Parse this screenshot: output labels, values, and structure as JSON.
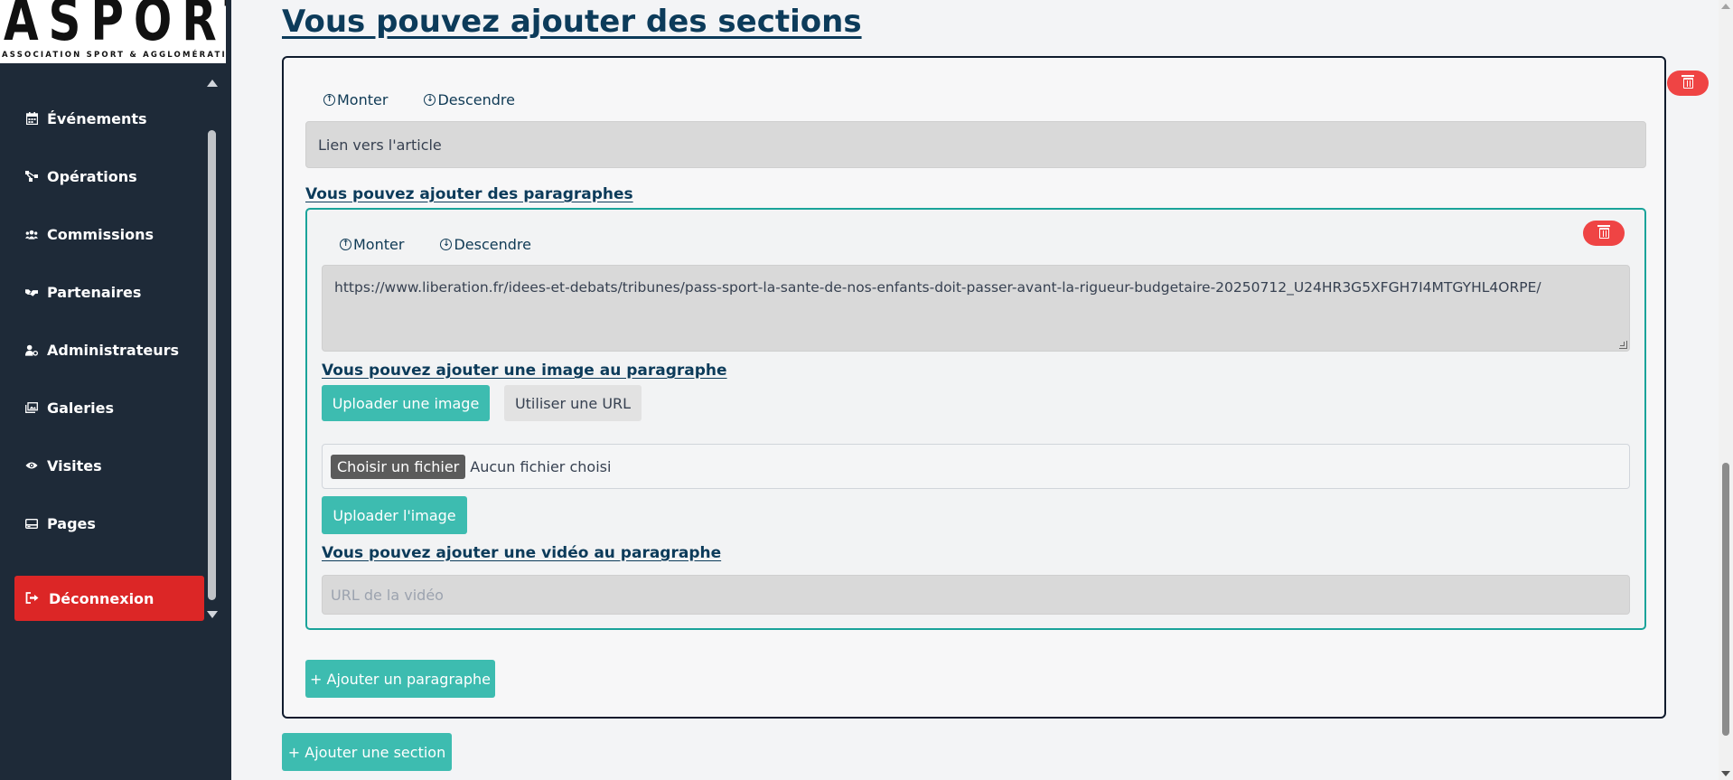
{
  "brand": {
    "logo_text": "ASPORTA",
    "logo_subtitle": "ASSOCIATION SPORT & AGGLOMÉRATIONS"
  },
  "sidebar": {
    "items": [
      {
        "label": "Événements",
        "icon": "calendar-icon"
      },
      {
        "label": "Opérations",
        "icon": "network-icon"
      },
      {
        "label": "Commissions",
        "icon": "users-icon"
      },
      {
        "label": "Partenaires",
        "icon": "handshake-icon"
      },
      {
        "label": "Administrateurs",
        "icon": "user-gear-icon"
      },
      {
        "label": "Galeries",
        "icon": "images-icon"
      },
      {
        "label": "Visites",
        "icon": "eye-icon"
      },
      {
        "label": "Pages",
        "icon": "card-icon"
      }
    ],
    "logout_label": "Déconnexion",
    "logout_color": "#dc2626"
  },
  "main": {
    "title": "Vous pouvez ajouter des sections",
    "section": {
      "move_up_label": "Monter",
      "move_down_label": "Descendre",
      "link_input_value": "Lien vers l'article",
      "paragraphs_heading": "Vous pouvez ajouter des paragraphes",
      "paragraph": {
        "move_up_label": "Monter",
        "move_down_label": "Descendre",
        "text_value": "https://www.liberation.fr/idees-et-debats/tribunes/pass-sport-la-sante-de-nos-enfants-doit-passer-avant-la-rigueur-budgetaire-20250712_U24HR3G5XFGH7I4MTGYHL4ORPE/",
        "image_heading": "Vous pouvez ajouter une image au paragraphe",
        "upload_tab_label": "Uploader une image",
        "url_tab_label": "Utiliser une URL",
        "file_button_label": "Choisir un fichier",
        "file_status": "Aucun fichier choisi",
        "upload_button_label": "Uploader l'image",
        "video_heading": "Vous pouvez ajouter une vidéo au paragraphe",
        "video_placeholder": "URL de la vidéo"
      },
      "add_paragraph_label": "+ Ajouter un paragraphe"
    },
    "add_section_label": "+ Ajouter une section"
  },
  "colors": {
    "accent": "#3dbcb0",
    "heading": "#0c3b5a",
    "danger": "#ef4444",
    "sidebar_bg": "#1e2a38"
  }
}
